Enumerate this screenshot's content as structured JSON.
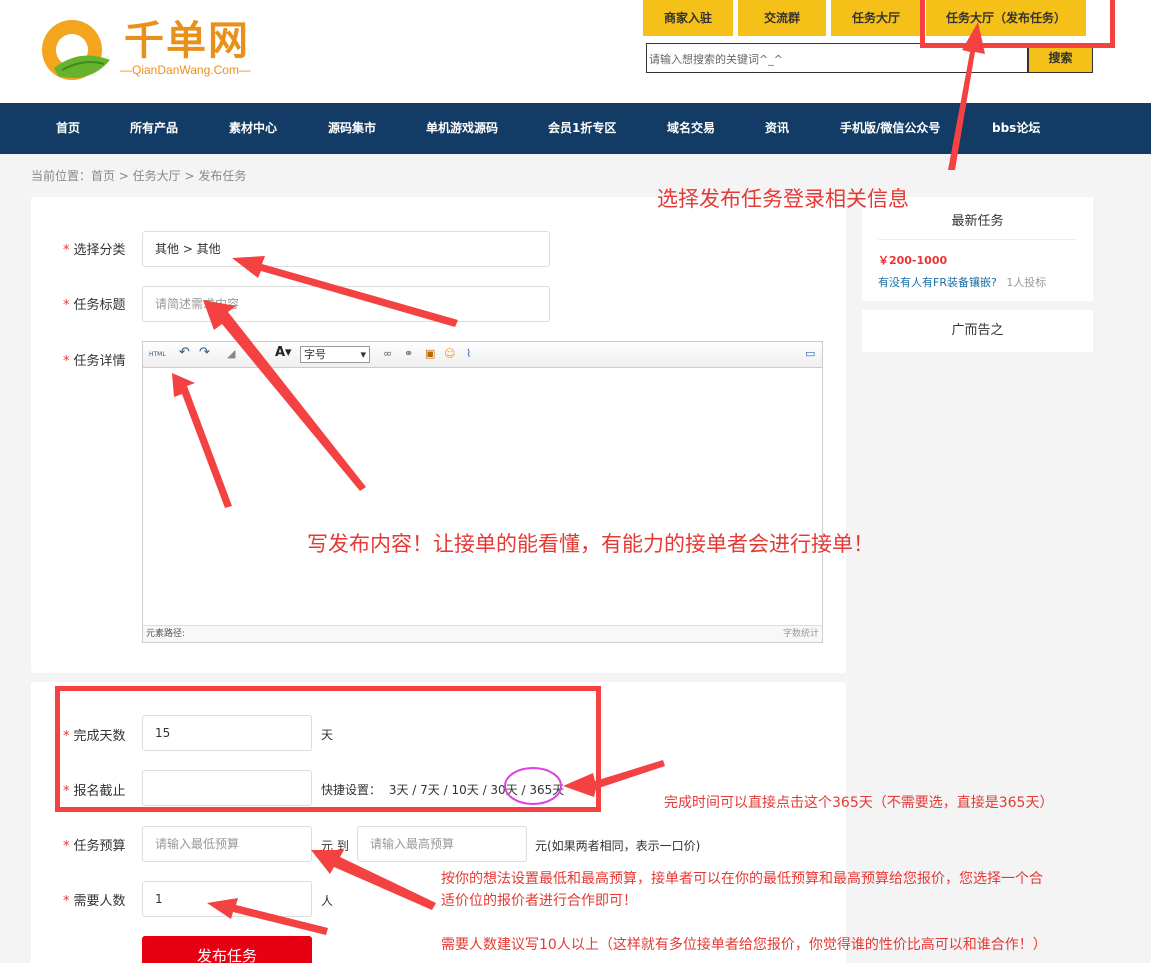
{
  "logo": {
    "cn": "千单网",
    "en": "—QianDanWang.Com—"
  },
  "toplinks": [
    "商家入驻",
    "交流群",
    "任务大厅",
    "任务大厅（发布任务）"
  ],
  "search": {
    "placeholder": "请输入想搜索的关键词^_^",
    "button": "搜索"
  },
  "nav": [
    "首页",
    "所有产品",
    "素材中心",
    "源码集市",
    "单机游戏源码",
    "会员1折专区",
    "域名交易",
    "资讯",
    "手机版/微信公众号",
    "bbs论坛"
  ],
  "breadcrumb": "当前位置：首页 > 任务大厅 > 发布任务",
  "form": {
    "category_label": "选择分类",
    "category_value": "其他 > 其他",
    "title_label": "任务标题",
    "title_placeholder": "请简述需求内容",
    "detail_label": "任务详情",
    "editor_font_size": "字号",
    "editor_path": "元素路径:",
    "editor_count": "字数统计",
    "days_label": "完成天数",
    "days_value": "15",
    "days_unit": "天",
    "deadline_label": "报名截止",
    "deadline_value": "",
    "quick_label": "快捷设置：",
    "quick_options": [
      "3天",
      "7天",
      "10天",
      "30天",
      "365天"
    ],
    "budget_label": "任务预算",
    "budget_min_placeholder": "请输入最低预算",
    "budget_to": "元 到",
    "budget_max_placeholder": "请输入最高预算",
    "budget_note": "元(如果两者相同，表示一口价)",
    "people_label": "需要人数",
    "people_value": "1",
    "people_unit": "人",
    "submit": "发布任务"
  },
  "sidebar": {
    "latest_title": "最新任务",
    "task_price": "￥200-1000",
    "task_title": "有没有人有FR装备镶嵌?",
    "task_bids": "1人投标",
    "ad": "广而告之"
  },
  "annotations": {
    "a1": "选择发布任务登录相关信息",
    "a2": "写发布内容！让接单的能看懂，有能力的接单者会进行接单！",
    "a3": "完成时间可以直接点击这个365天（不需要选，直接是365天）",
    "a4_line1": "按你的想法设置最低和最高预算，接单者可以在你的最低预算和最高预算给您报价，您选择一个合",
    "a4_line2": "适价位的报价者进行合作即可！",
    "a5": "需要人数建议写10人以上（这样就有多位接单者给您报价，你觉得谁的性价比高可以和谁合作！）"
  },
  "colors": {
    "nav_bg": "#123c65",
    "accent": "#f5c118",
    "brand": "#e9901a",
    "submit": "#e60012",
    "annotation": "#e53935"
  }
}
